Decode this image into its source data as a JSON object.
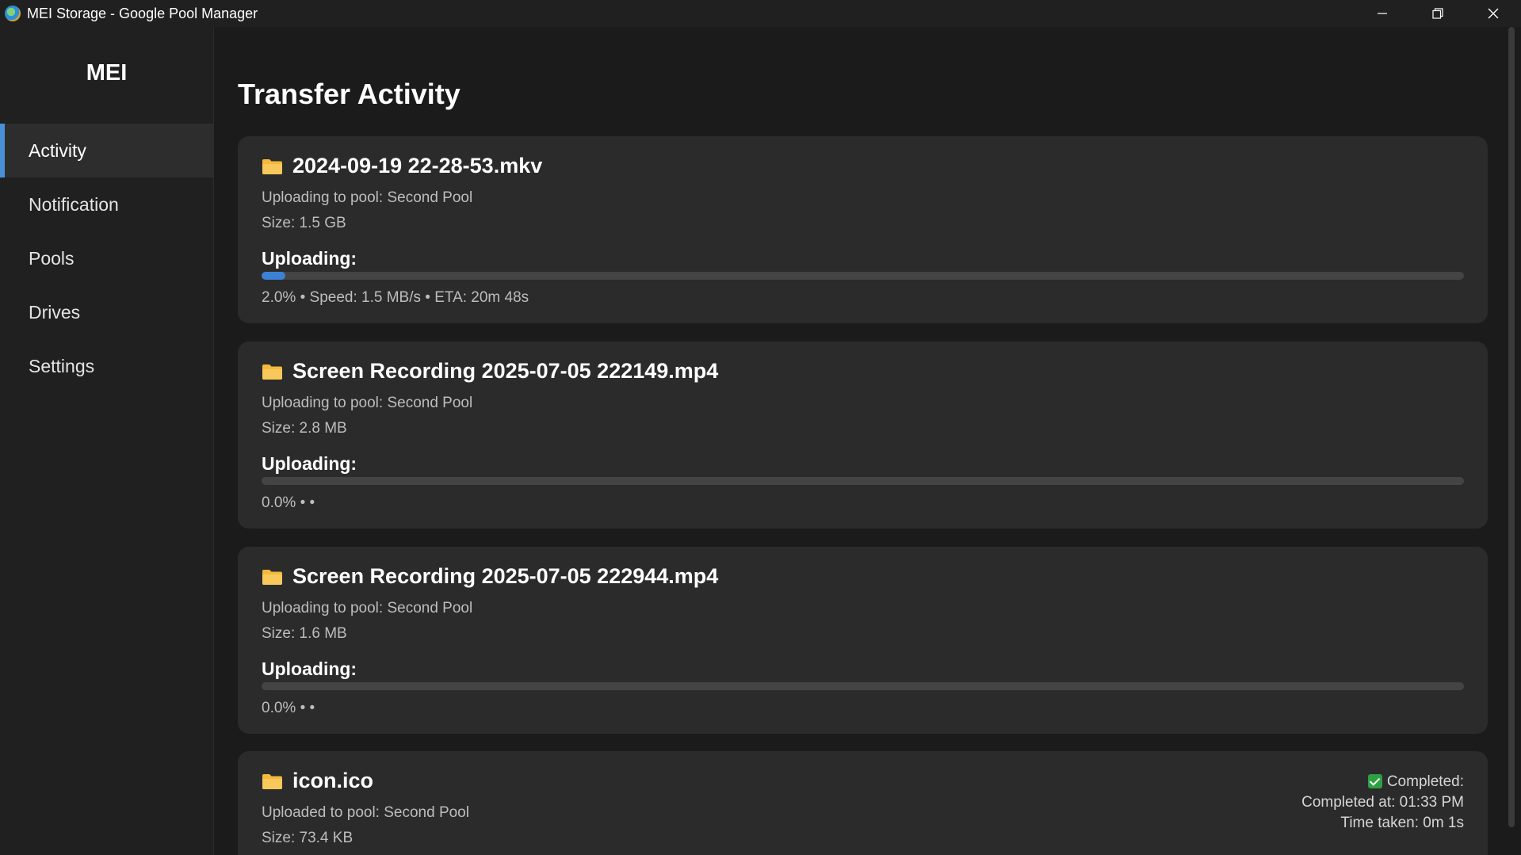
{
  "window": {
    "title": "MEI Storage - Google Pool Manager"
  },
  "sidebar": {
    "brand": "MEI",
    "items": [
      {
        "label": "Activity",
        "active": true
      },
      {
        "label": "Notification"
      },
      {
        "label": "Pools"
      },
      {
        "label": "Drives"
      },
      {
        "label": "Settings"
      }
    ]
  },
  "main": {
    "title": "Transfer Activity"
  },
  "transfers": [
    {
      "name": "2024-09-19 22-28-53.mkv",
      "pool_line": "Uploading to pool: Second Pool",
      "size_line": "Size: 1.5 GB",
      "status_label": "Uploading:",
      "progress_percent": 2.0,
      "stats": "2.0% • Speed: 1.5 MB/s • ETA: 20m 48s"
    },
    {
      "name": "Screen Recording 2025-07-05 222149.mp4",
      "pool_line": "Uploading to pool: Second Pool",
      "size_line": "Size: 2.8 MB",
      "status_label": "Uploading:",
      "progress_percent": 0.0,
      "stats": "0.0% • •"
    },
    {
      "name": "Screen Recording 2025-07-05 222944.mp4",
      "pool_line": "Uploading to pool: Second Pool",
      "size_line": "Size: 1.6 MB",
      "status_label": "Uploading:",
      "progress_percent": 0.0,
      "stats": "0.0% • •"
    },
    {
      "name": "icon.ico",
      "pool_line": "Uploaded to pool: Second Pool",
      "size_line": "Size: 73.4 KB",
      "completed_label": "Completed:",
      "completed_at": "Completed at: 01:33 PM",
      "time_taken": "Time taken: 0m 1s"
    }
  ],
  "colors": {
    "accent": "#3b82d6",
    "folder": "#f4b83c",
    "success": "#2ea043"
  }
}
